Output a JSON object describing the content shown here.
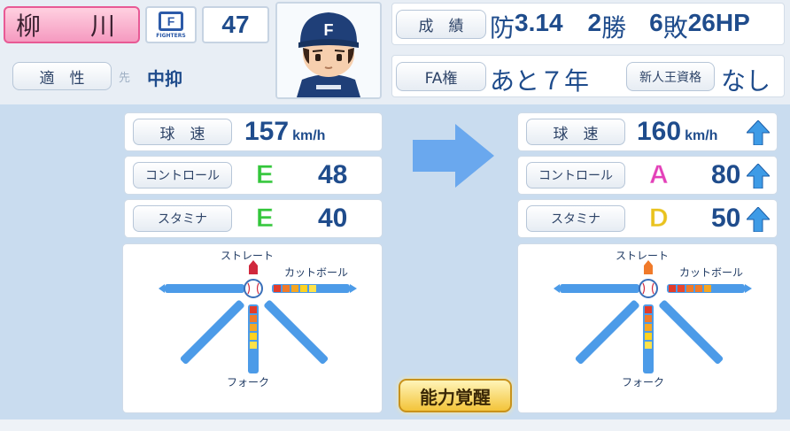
{
  "player": {
    "name": "柳　川",
    "number": "47",
    "team_logo_letter": "F",
    "team_logo_text": "FIGHTERS",
    "aptitude_label": "適　性",
    "aptitude_faint": "先",
    "aptitude_value": "中抑"
  },
  "record": {
    "label": "成　績",
    "era_label": "防",
    "era": "3.14",
    "wins": "2",
    "wins_unit": "勝",
    "losses": "6",
    "losses_unit": "敗",
    "holds": "26",
    "holds_unit": "HP"
  },
  "fa": {
    "label": "FA権",
    "value": "あと７年",
    "rookie_label": "新人王資格",
    "rookie_value": "なし"
  },
  "before": {
    "speed_label": "球　速",
    "speed": "157",
    "speed_unit": "km/h",
    "control_label": "コントロール",
    "control_grade": "E",
    "control": "48",
    "stamina_label": "スタミナ",
    "stamina_grade": "E",
    "stamina": "40",
    "pitches": {
      "straight": "ストレート",
      "cutball": "カットボール",
      "fork": "フォーク",
      "straight_variant": 1,
      "cutball_level": 5,
      "fork_level": 5
    }
  },
  "after": {
    "speed_label": "球　速",
    "speed": "160",
    "speed_unit": "km/h",
    "control_label": "コントロール",
    "control_grade": "A",
    "control": "80",
    "stamina_label": "スタミナ",
    "stamina_grade": "D",
    "stamina": "50",
    "pitches": {
      "straight": "ストレート",
      "cutball": "カットボール",
      "fork": "フォーク",
      "straight_variant": 1,
      "cutball_level": 5,
      "fork_level": 5
    }
  },
  "awaken_label": "能力覚醒",
  "colors": {
    "grade_E": "#32c63a",
    "grade_A": "#e33fb8",
    "grade_D": "#e9c21d",
    "accent_blue": "#1f4c8c",
    "arrow_blue": "#6aa8ee",
    "up_arrow": "#3e9be6"
  }
}
